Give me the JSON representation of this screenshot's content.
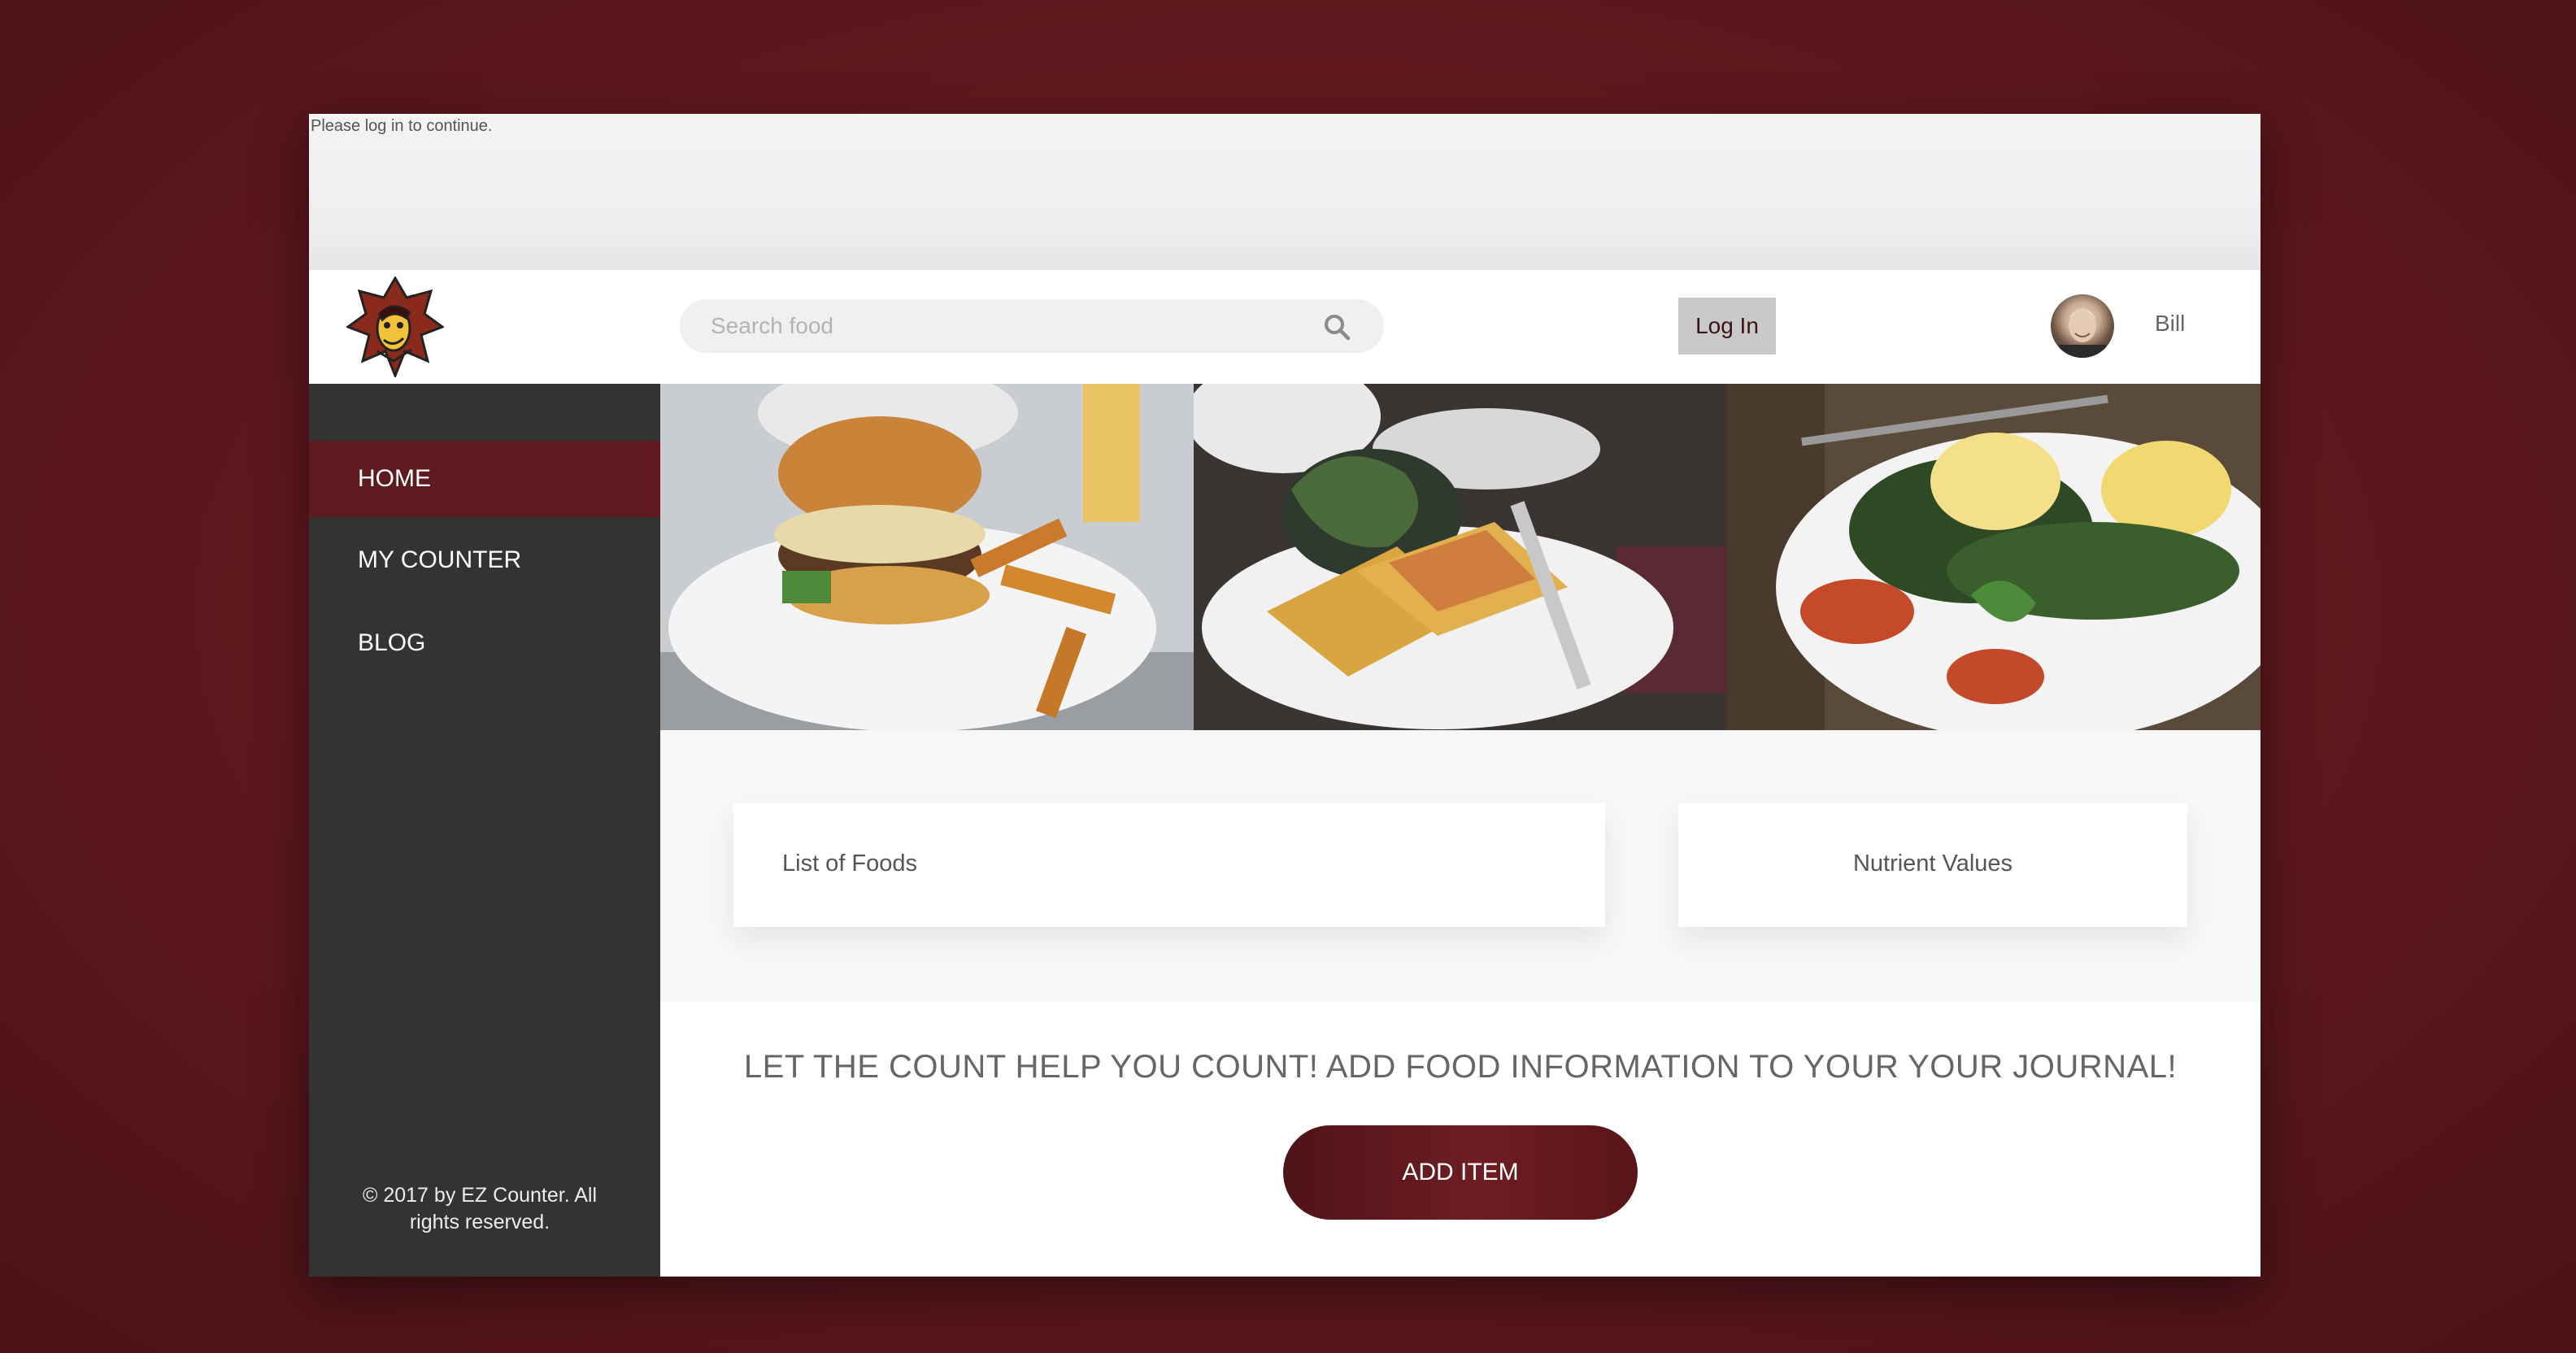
{
  "notice": {
    "text": "Please log in to continue."
  },
  "header": {
    "search_placeholder": "Search food",
    "login_label": "Log In",
    "user_name": "Bill"
  },
  "sidebar": {
    "items": [
      {
        "label": "HOME",
        "active": true
      },
      {
        "label": "MY COUNTER",
        "active": false
      },
      {
        "label": "BLOG",
        "active": false
      }
    ],
    "footer": "© 2017 by EZ Counter. All rights reserved."
  },
  "hero": {
    "images": [
      "burger-with-fries-photo",
      "grilled-wrap-with-salad-photo",
      "eggs-benedict-photo"
    ]
  },
  "main": {
    "card_foods": "List of Foods",
    "card_nutrients": "Nutrient Values",
    "cta_text": "LET THE COUNT HELP YOU COUNT! ADD FOOD INFORMATION TO YOUR YOUR JOURNAL!",
    "add_button": "ADD ITEM"
  },
  "colors": {
    "brand": "#5e1a1f",
    "sidebar": "#333333",
    "background": "#6b1c21"
  }
}
